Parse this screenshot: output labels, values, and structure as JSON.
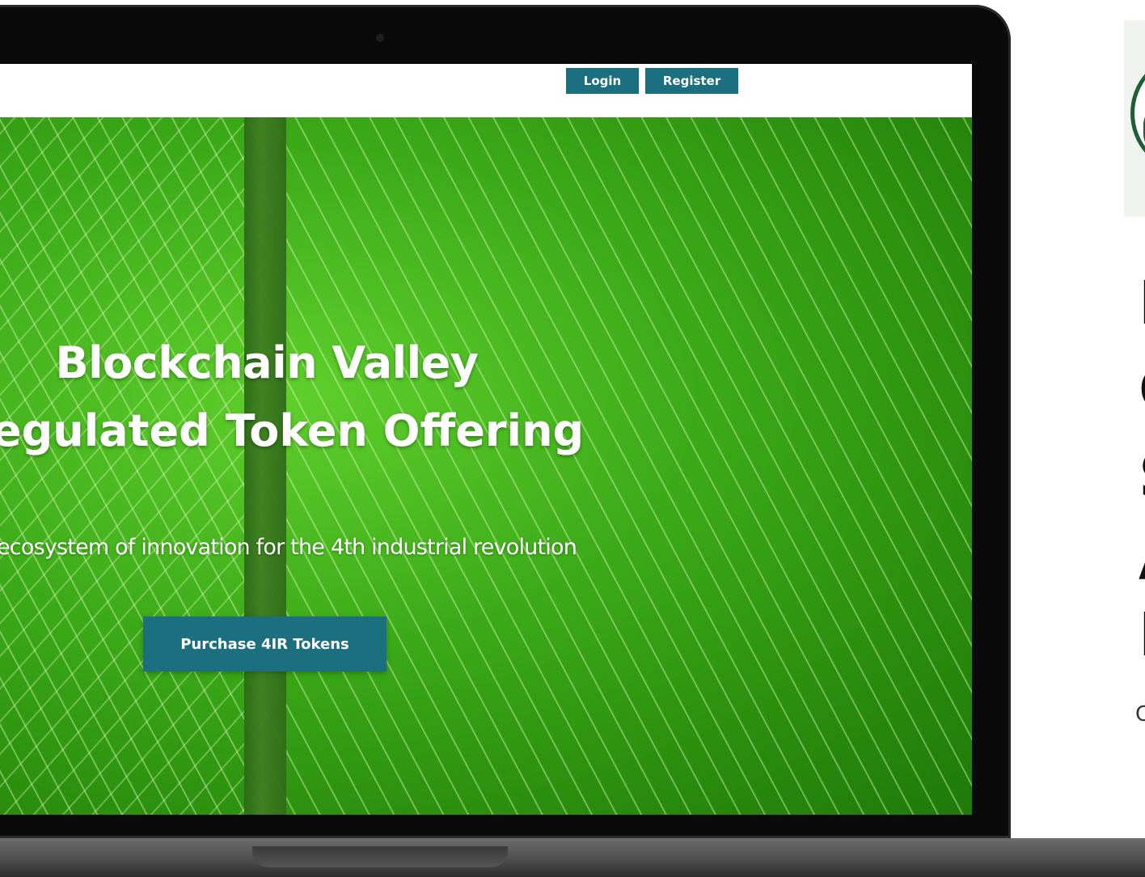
{
  "nav": {
    "login_label": "Login",
    "register_label": "Register"
  },
  "hero": {
    "title": "Blockchain Valley",
    "subtitle": "egulated Token Offering",
    "tagline": "ecosystem of innovation for the 4th industrial revolution",
    "cta_label": "Purchase 4IR Tokens"
  },
  "side_panel": {
    "letters": [
      "I",
      "C",
      "S",
      "A",
      "I"
    ],
    "caption_char": "C"
  },
  "colors": {
    "button_teal": "#1c6f7e",
    "leaf_green": "#3aa817",
    "logo_green": "#1e5f35"
  }
}
